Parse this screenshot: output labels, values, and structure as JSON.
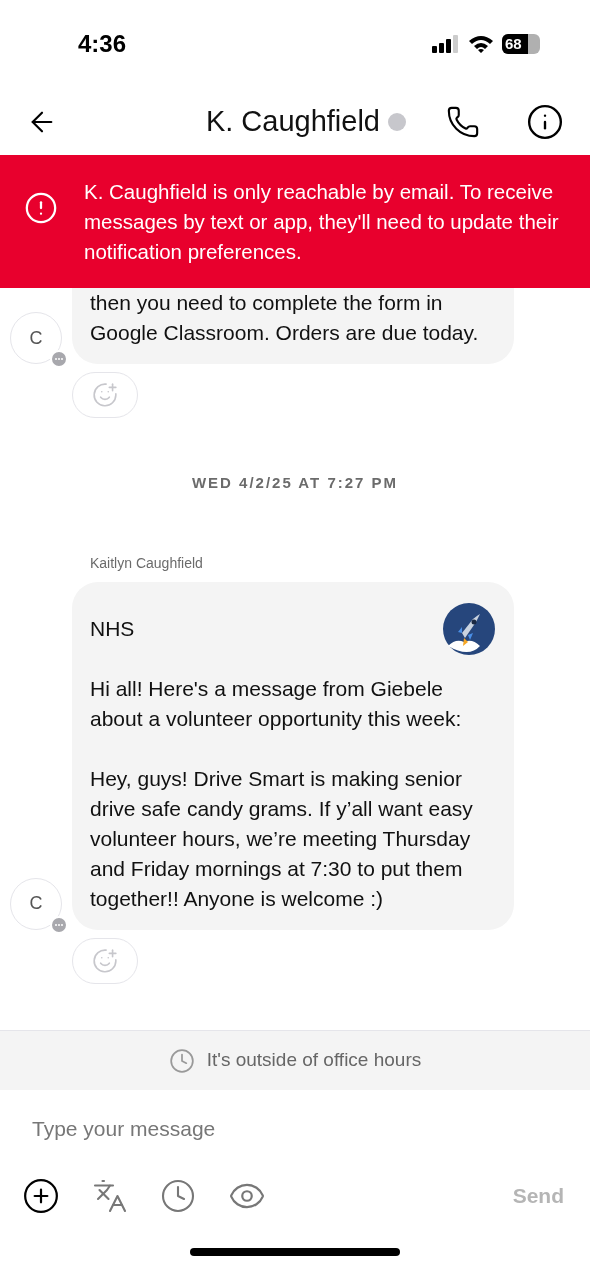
{
  "status_bar": {
    "time": "4:36",
    "battery": "68"
  },
  "header": {
    "title": "K. Caughfield"
  },
  "alert": {
    "text": "K. Caughfield is only reachable by email. To receive messages by text or app, they'll need to update their notification preferences."
  },
  "messages": [
    {
      "kind": "message",
      "avatar": "C",
      "paragraphs": [
        "then you need to complete the form in Google Classroom. Orders are due today."
      ],
      "cut_top": true
    },
    {
      "kind": "date",
      "text": "WED 4/2/25 AT 7:27 PM"
    },
    {
      "kind": "message",
      "sender": "Kaitlyn Caughfield",
      "avatar": "C",
      "group": "NHS",
      "paragraphs": [
        "Hi all! Here's a message from Giebele about a volunteer opportunity this week:",
        "Hey, guys! Drive Smart is making senior drive safe candy grams. If y’all want easy volunteer hours, we’re meeting Thursday and Friday mornings at 7:30 to put them together!! Anyone is welcome :)"
      ],
      "cut_top": false
    }
  ],
  "office_notice": "It's outside of office hours",
  "composer": {
    "placeholder": "Type your message",
    "send": "Send"
  }
}
